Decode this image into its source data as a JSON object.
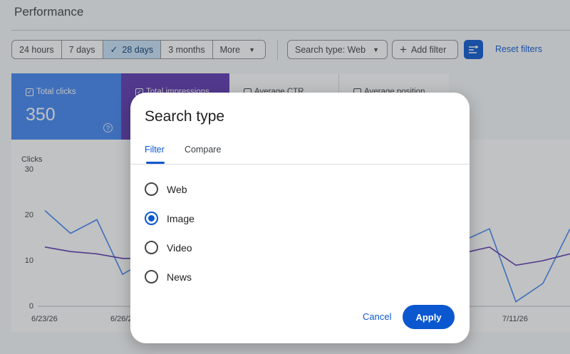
{
  "page": {
    "title": "Performance"
  },
  "date_range": {
    "options": [
      {
        "label": "24 hours",
        "selected": false
      },
      {
        "label": "7 days",
        "selected": false
      },
      {
        "label": "28 days",
        "selected": true
      },
      {
        "label": "3 months",
        "selected": false
      },
      {
        "label": "More",
        "selected": false
      }
    ]
  },
  "filters": {
    "search_type": "Search type: Web",
    "add_filter": "Add filter",
    "reset": "Reset filters"
  },
  "metrics": [
    {
      "label": "Total clicks",
      "value": "350",
      "checked": true,
      "color": "#4285f4"
    },
    {
      "label": "Total impressions",
      "checked": true,
      "color": "#5e35b1"
    },
    {
      "label": "Average CTR",
      "checked": false
    },
    {
      "label": "Average position",
      "checked": false
    }
  ],
  "chart_data": {
    "type": "line",
    "ylabel": "Clicks",
    "yticks": [
      "30",
      "20",
      "10",
      "0"
    ],
    "xticks": [
      "6/23/26",
      "6/26/26",
      "7/11/26"
    ],
    "ylim": [
      0,
      30
    ],
    "series": [
      {
        "color": "#4285f4",
        "values": [
          21,
          16,
          19,
          7,
          8
        ]
      },
      {
        "color": "#5e35b1",
        "values": [
          13,
          12,
          11.5,
          10.5,
          10.5
        ]
      }
    ],
    "series_right": [
      {
        "color": "#4285f4",
        "values": [
          15,
          17,
          1,
          5,
          17
        ]
      },
      {
        "color": "#5e35b1",
        "values": [
          12,
          13,
          9,
          10,
          11.5
        ]
      }
    ]
  },
  "dialog": {
    "title": "Search type",
    "tabs": [
      {
        "label": "Filter",
        "active": true
      },
      {
        "label": "Compare",
        "active": false
      }
    ],
    "options": [
      {
        "label": "Web",
        "selected": false
      },
      {
        "label": "Image",
        "selected": true
      },
      {
        "label": "Video",
        "selected": false
      },
      {
        "label": "News",
        "selected": false
      }
    ],
    "cancel": "Cancel",
    "apply": "Apply"
  }
}
